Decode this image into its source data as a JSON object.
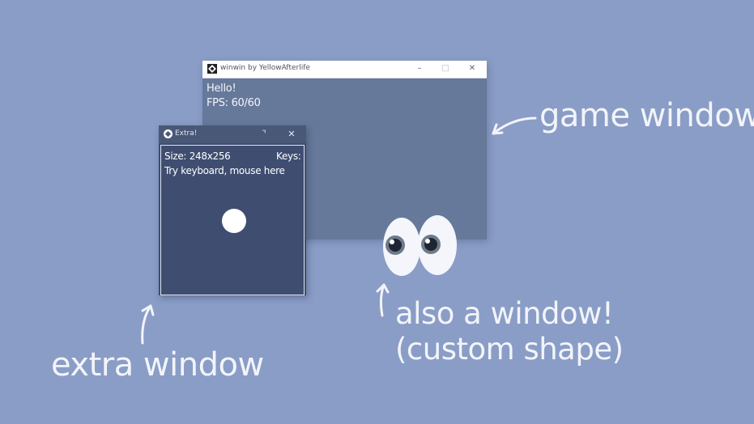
{
  "game_window": {
    "title": "winwin by YellowAfterlife",
    "controls": {
      "minimize": "–",
      "maximize": "□",
      "close": "✕"
    },
    "lines": [
      "Hello!",
      "FPS: 60/60"
    ]
  },
  "extra_window": {
    "title": "Extra!",
    "controls": {
      "resize": "⌝",
      "close": "✕"
    },
    "size_text": "Size: 248x256",
    "keys_text": "Keys:",
    "hint_text": "Try keyboard, mouse here"
  },
  "annotations": {
    "game_window": "game window",
    "extra_window": "extra window",
    "also_window_line1": "also a window!",
    "also_window_line2": "(custom shape)"
  },
  "colors": {
    "desktop": "#8a9dc6",
    "game_client": "#66799a",
    "extra_client": "#3f4d70"
  },
  "icons": [
    "app-icon",
    "eyes-icon",
    "arrow-icon"
  ]
}
